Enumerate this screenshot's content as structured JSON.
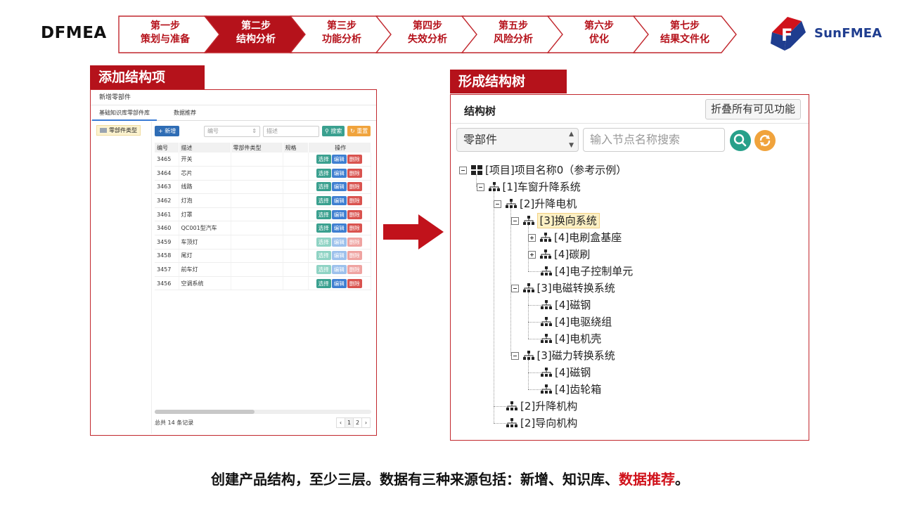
{
  "brand": "DFMEA",
  "steps": [
    {
      "line1": "第一步",
      "line2": "策划与准备",
      "active": false
    },
    {
      "line1": "第二步",
      "line2": "结构分析",
      "active": true
    },
    {
      "line1": "第三步",
      "line2": "功能分析",
      "active": false
    },
    {
      "line1": "第四步",
      "line2": "失效分析",
      "active": false
    },
    {
      "line1": "第五步",
      "line2": "风险分析",
      "active": false
    },
    {
      "line1": "第六步",
      "line2": "优化",
      "active": false
    },
    {
      "line1": "第七步",
      "line2": "结果文件化",
      "active": false
    }
  ],
  "logo_text": "SunFMEA",
  "colors": {
    "accent": "#b5121b",
    "logo_blue": "#1f3d8f",
    "logo_red": "#d0121b"
  },
  "left": {
    "section_title": "添加结构项",
    "dialog_title": "新增零部件",
    "tabs": [
      "基础知识库零部件库",
      "数据推荐"
    ],
    "tree_item": "零部件类型",
    "toolbar": {
      "new": "+ 新增",
      "code_placeholder": "编号",
      "desc_placeholder": "描述",
      "search": "搜索",
      "reset": "重置"
    },
    "columns": [
      "编号",
      "描述",
      "零部件类型",
      "规格",
      "操作"
    ],
    "actions": [
      "选择",
      "编辑",
      "删除"
    ],
    "rows": [
      {
        "code": "3465",
        "desc": "开关",
        "dim": false
      },
      {
        "code": "3464",
        "desc": "芯片",
        "dim": false
      },
      {
        "code": "3463",
        "desc": "线路",
        "dim": false
      },
      {
        "code": "3462",
        "desc": "灯泡",
        "dim": false
      },
      {
        "code": "3461",
        "desc": "灯罩",
        "dim": false
      },
      {
        "code": "3460",
        "desc": "QC001型汽车",
        "dim": false
      },
      {
        "code": "3459",
        "desc": "车顶灯",
        "dim": true
      },
      {
        "code": "3458",
        "desc": "尾灯",
        "dim": true
      },
      {
        "code": "3457",
        "desc": "前车灯",
        "dim": true
      },
      {
        "code": "3456",
        "desc": "空调系统",
        "dim": false
      }
    ],
    "footer": "总共 14 条记录",
    "pager": [
      "‹",
      "1",
      "2",
      "›"
    ]
  },
  "right": {
    "section_title": "形成结构树",
    "panel_title": "结构树",
    "collapse_button": "折叠所有可见功能",
    "select_value": "零部件",
    "search_placeholder": "输入节点名称搜索",
    "tree": [
      {
        "label": "[项目]项目名称0（参考示例）",
        "depth": 0,
        "toggle": "minus",
        "icon": "grid-icon"
      },
      {
        "label": "[1]车窗升降系统",
        "depth": 1,
        "toggle": "minus",
        "icon": "hierarchy-icon"
      },
      {
        "label": "[2]升降电机",
        "depth": 2,
        "toggle": "minus",
        "icon": "hierarchy-icon"
      },
      {
        "label": "[3]换向系统",
        "depth": 3,
        "toggle": "minus",
        "icon": "hierarchy-icon",
        "selected": true
      },
      {
        "label": "[4]电刷盒基座",
        "depth": 4,
        "toggle": "plus",
        "icon": "hierarchy-icon"
      },
      {
        "label": "[4]碳刷",
        "depth": 4,
        "toggle": "plus",
        "icon": "hierarchy-icon"
      },
      {
        "label": "[4]电子控制单元",
        "depth": 4,
        "toggle": "none",
        "icon": "hierarchy-icon"
      },
      {
        "label": "[3]电磁转换系统",
        "depth": 3,
        "toggle": "minus",
        "icon": "hierarchy-icon"
      },
      {
        "label": "[4]磁钢",
        "depth": 4,
        "toggle": "none",
        "icon": "hierarchy-icon"
      },
      {
        "label": "[4]电驱绕组",
        "depth": 4,
        "toggle": "none",
        "icon": "hierarchy-icon"
      },
      {
        "label": "[4]电机壳",
        "depth": 4,
        "toggle": "none",
        "icon": "hierarchy-icon"
      },
      {
        "label": "[3]磁力转换系统",
        "depth": 3,
        "toggle": "minus",
        "icon": "hierarchy-icon"
      },
      {
        "label": "[4]磁钢",
        "depth": 4,
        "toggle": "none",
        "icon": "hierarchy-icon"
      },
      {
        "label": "[4]齿轮箱",
        "depth": 4,
        "toggle": "none",
        "icon": "hierarchy-icon"
      },
      {
        "label": "[2]升降机构",
        "depth": 2,
        "toggle": "none",
        "icon": "hierarchy-icon"
      },
      {
        "label": "[2]导向机构",
        "depth": 2,
        "toggle": "none",
        "icon": "hierarchy-icon"
      }
    ]
  },
  "caption": {
    "main": "创建产品结构，至少三层。数据有三种来源包括：新增、知识库、",
    "highlight": "数据推荐",
    "end": "。"
  }
}
